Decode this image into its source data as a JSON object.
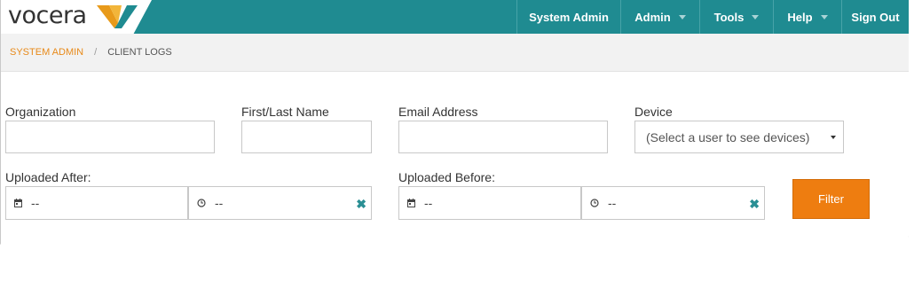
{
  "header": {
    "logo_text": "vocera",
    "nav": [
      {
        "label": "System Admin",
        "dropdown": false
      },
      {
        "label": "Admin",
        "dropdown": true
      },
      {
        "label": "Tools",
        "dropdown": true
      },
      {
        "label": "Help",
        "dropdown": true
      },
      {
        "label": "Sign Out",
        "dropdown": false
      }
    ]
  },
  "breadcrumb": {
    "parent": "System Admin",
    "separator": "/",
    "current": "Client Logs"
  },
  "filters": {
    "organization_label": "Organization",
    "organization_value": "",
    "name_label": "First/Last Name",
    "name_value": "",
    "email_label": "Email Address",
    "email_value": "",
    "device_label": "Device",
    "device_value": "(Select a user to see devices)",
    "uploaded_after_label": "Uploaded After:",
    "uploaded_after_date": "--",
    "uploaded_after_time": "--",
    "uploaded_before_label": "Uploaded Before:",
    "uploaded_before_date": "--",
    "uploaded_before_time": "--",
    "filter_button": "Filter"
  },
  "colors": {
    "header_teal": "#1f8b91",
    "accent_orange": "#ee7d10",
    "breadcrumb_link": "#e88a1a"
  },
  "icons": [
    "calendar-icon",
    "clock-icon",
    "clear-icon",
    "caret-down-icon"
  ]
}
